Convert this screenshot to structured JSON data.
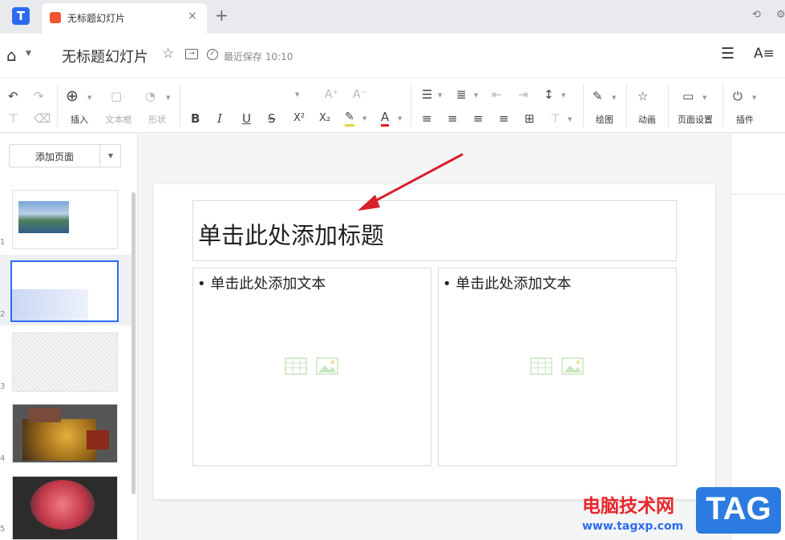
{
  "colors": {
    "accent": "#2c6bf0",
    "tab_icon": "#f0552e",
    "arrow": "#d9202a",
    "highlight": "#e8d23a",
    "font_color": "#e02020",
    "watermark_red": "#e8262a",
    "watermark_blue": "#2c7be0"
  },
  "tabbar": {
    "app_icon": "kdocs-logo",
    "tab_title": "无标题幻灯片",
    "close": "×",
    "add": "+"
  },
  "header": {
    "title": "无标题幻灯片",
    "save_status": "最近保存 10:10"
  },
  "ribbon": {
    "insert": "插入",
    "textbox": "文本框",
    "shape": "形状",
    "draw": "绘图",
    "animation": "动画",
    "page_setup": "页面设置",
    "plugin": "插件",
    "glyphs": {
      "bold": "B",
      "italic": "I",
      "underline": "U",
      "strike": "S",
      "superscript": "X²",
      "subscript": "X₂",
      "font_color": "A",
      "font_up": "A⁺",
      "font_down": "A⁻"
    }
  },
  "sidebar": {
    "add_page": "添加页面",
    "slide_numbers": [
      "1",
      "2",
      "3",
      "4",
      "5"
    ]
  },
  "slide": {
    "title_placeholder": "单击此处添加标题",
    "left_body_placeholder": "• 单击此处添加文本",
    "right_body_placeholder": "• 单击此处添加文本"
  },
  "watermark": {
    "site_name": "电脑技术网",
    "url": "www.tagxp.com",
    "tag": "TAG"
  }
}
